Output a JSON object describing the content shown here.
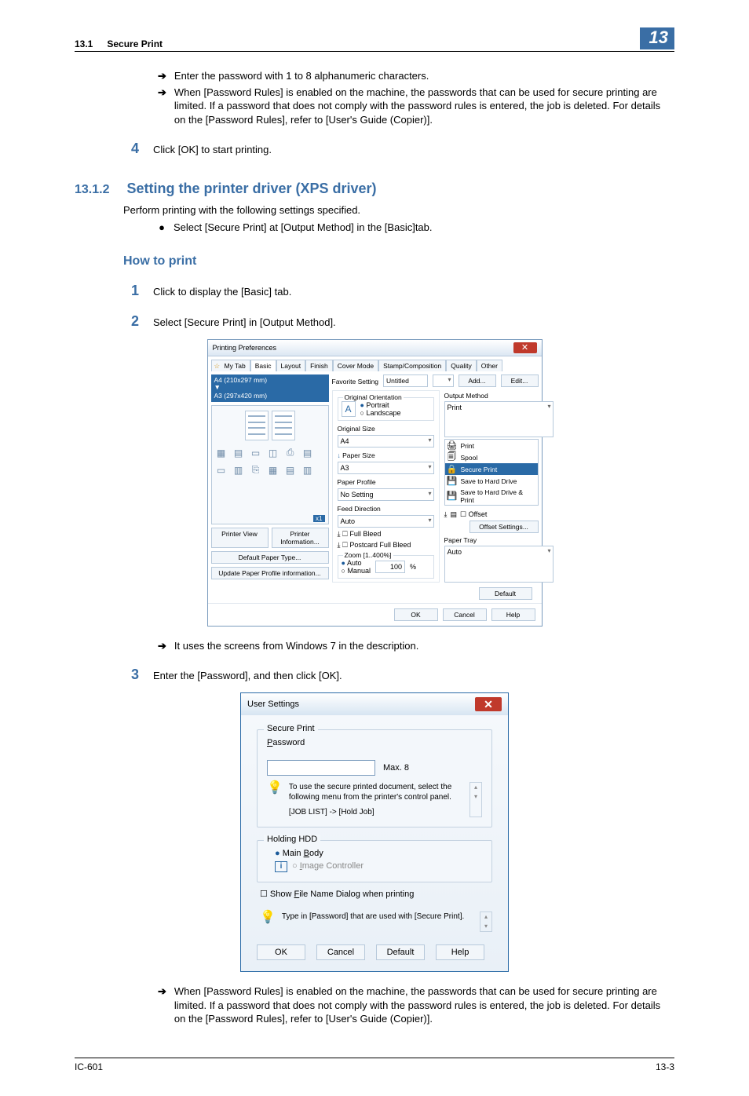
{
  "header": {
    "section_num": "13.1",
    "section_title": "Secure Print",
    "chapter": "13"
  },
  "intro_arrows": [
    "Enter the password with 1 to 8 alphanumeric characters.",
    "When [Password Rules] is enabled on the machine, the passwords that can be used for secure printing are limited. If a password that does not comply with the password rules is entered, the job is deleted. For details on the [Password Rules], refer to [User's Guide (Copier)]."
  ],
  "step4": {
    "num": "4",
    "text": "Click [OK] to start printing."
  },
  "subsection": {
    "num": "13.1.2",
    "title": "Setting the printer driver (XPS driver)",
    "intro": "Perform printing with the following settings specified.",
    "bullet": "Select [Secure Print] at [Output Method] in the [Basic]tab."
  },
  "how_to_print_heading": "How to print",
  "step1": {
    "num": "1",
    "text": "Click to display the [Basic] tab."
  },
  "step2": {
    "num": "2",
    "text": "Select [Secure Print] in [Output Method]."
  },
  "dlg1": {
    "title": "Printing Preferences",
    "tabs": [
      "My Tab",
      "Basic",
      "Layout",
      "Finish",
      "Cover Mode",
      "Stamp/Composition",
      "Quality",
      "Other"
    ],
    "preview": {
      "size1": "A4 (210x297 mm)",
      "size2": "A3 (297x420 mm)",
      "x1": "x1"
    },
    "left_buttons": {
      "printer_view": "Printer View",
      "printer_info": "Printer Information...",
      "default_paper": "Default Paper Type...",
      "update_profile": "Update Paper Profile information..."
    },
    "fav": {
      "label": "Favorite Setting",
      "value": "Untitled",
      "add": "Add...",
      "edit": "Edit..."
    },
    "orientation": {
      "group": "Original Orientation",
      "portrait": "Portrait",
      "landscape": "Landscape"
    },
    "osize": {
      "label": "Original Size",
      "value": "A4"
    },
    "psize": {
      "label_prefix": "↓",
      "label": "Paper Size",
      "value": "A3"
    },
    "pprofile": {
      "label": "Paper Profile",
      "value": "No Setting"
    },
    "feed": {
      "label": "Feed Direction",
      "value": "Auto"
    },
    "fullbleed": "Full Bleed",
    "postcard": "Postcard Full Bleed",
    "zoom": {
      "group": "Zoom [1..400%]",
      "auto": "Auto",
      "manual": "Manual",
      "value": "100",
      "x": "%"
    },
    "output_method": {
      "label": "Output Method",
      "selected": "Print",
      "items": [
        "Print",
        "Spool",
        "Secure Print",
        "Save to Hard Drive",
        "Save to Hard Drive & Print"
      ]
    },
    "offset": {
      "chk": "Offset",
      "btn": "Offset Settings..."
    },
    "paper_tray": {
      "label": "Paper Tray",
      "value": "Auto"
    },
    "default_btn": "Default",
    "footer": {
      "ok": "OK",
      "cancel": "Cancel",
      "help": "Help"
    }
  },
  "post_dlg1_arrow": "It uses the screens from Windows 7 in the description.",
  "step3": {
    "num": "3",
    "text": "Enter the [Password], and then click [OK]."
  },
  "dlg2": {
    "title": "User Settings",
    "secure_group": "Secure Print",
    "pw_label": "Password",
    "pw_max": "Max. 8",
    "info1a": "To use the secure printed document, select the following menu from the printer's control panel.",
    "info1b": "[JOB LIST] -> [Hold Job]",
    "hdd_group": "Holding HDD",
    "hdd_main": "Main Body",
    "hdd_image": "Image Controller",
    "show_file": "Show File Name Dialog when printing",
    "info2": "Type in [Password] that are used with [Secure Print].",
    "footer": {
      "ok": "OK",
      "cancel": "Cancel",
      "default": "Default",
      "help": "Help"
    }
  },
  "post_dlg2_arrow": "When [Password Rules] is enabled on the machine, the passwords that can be used for secure printing are limited. If a password that does not comply with the password rules is entered, the job is deleted. For details on the [Password Rules], refer to [User's Guide (Copier)].",
  "footer": {
    "left": "IC-601",
    "right": "13-3"
  }
}
